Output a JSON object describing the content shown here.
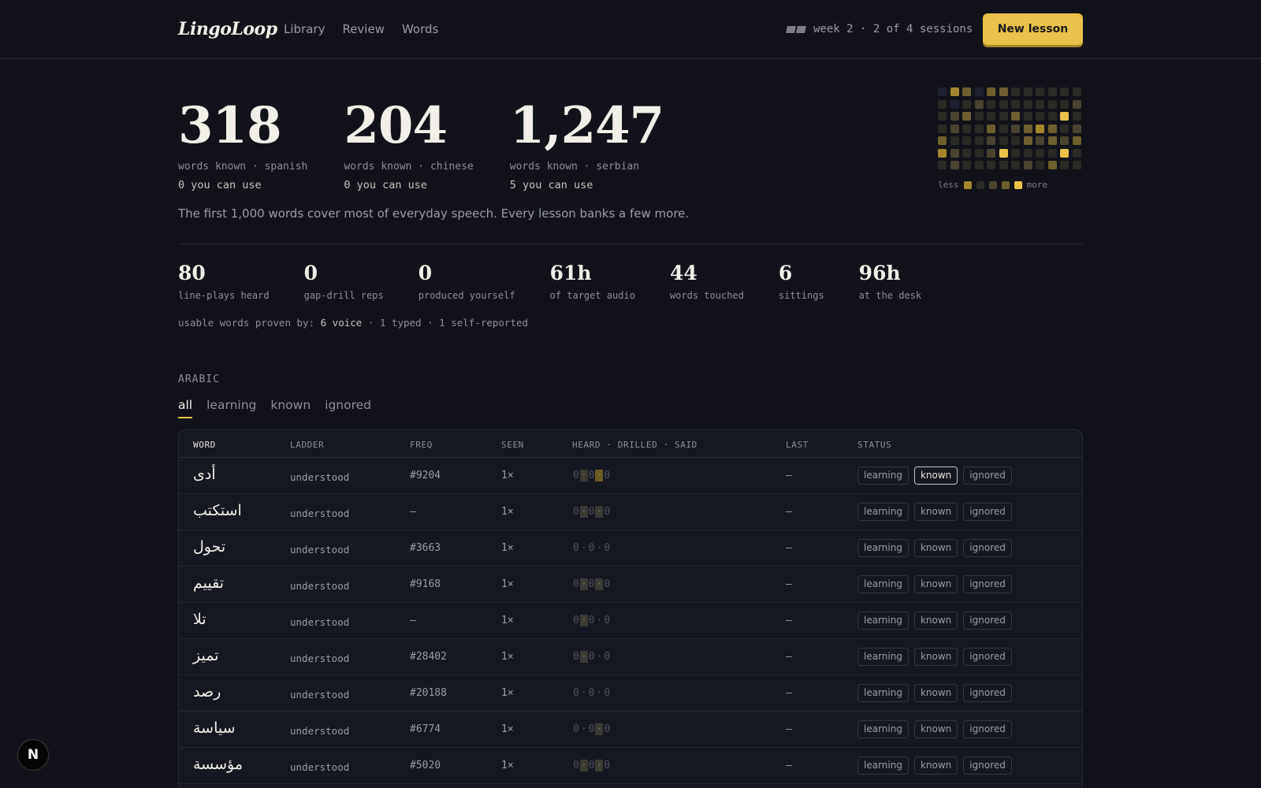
{
  "app": {
    "logo": "LingoLoop"
  },
  "nav": {
    "items": [
      "Library",
      "Review",
      "Words"
    ]
  },
  "header": {
    "week_status": "week 2 · 2 of 4 sessions",
    "new_lesson": "New lesson"
  },
  "hero": {
    "stats": [
      {
        "value": "318",
        "label": "words known · spanish",
        "usable": "0 you can use"
      },
      {
        "value": "204",
        "label": "words known · chinese",
        "usable": "0 you can use"
      },
      {
        "value": "1,247",
        "label": "words known · serbian",
        "usable": "5 you can use"
      }
    ],
    "tagline": "The first 1,000 words cover most of everyday speech. Every lesson banks a few more."
  },
  "heatmap": {
    "less": "less",
    "more": "more",
    "colors": [
      "#1e2130",
      "#2b2a25",
      "#4a4330",
      "#6e5f30",
      "#a3872e",
      "#e8c24a"
    ],
    "levels": [
      [
        0,
        4,
        3,
        0,
        3,
        3,
        1,
        1,
        1,
        1,
        1,
        1
      ],
      [
        1,
        0,
        1,
        2,
        1,
        1,
        1,
        1,
        1,
        1,
        1,
        2
      ],
      [
        1,
        2,
        3,
        1,
        1,
        1,
        3,
        1,
        1,
        1,
        5,
        1
      ],
      [
        1,
        2,
        1,
        1,
        3,
        1,
        2,
        3,
        4,
        3,
        1,
        2
      ],
      [
        3,
        1,
        1,
        1,
        2,
        1,
        1,
        3,
        2,
        3,
        2,
        3
      ],
      [
        4,
        2,
        1,
        1,
        2,
        5,
        1,
        1,
        1,
        1,
        5,
        1
      ],
      [
        1,
        2,
        1,
        1,
        1,
        1,
        1,
        2,
        1,
        3,
        1,
        1
      ]
    ],
    "legend_levels": [
      4,
      1,
      2,
      3,
      5
    ]
  },
  "small_stats": [
    {
      "value": "80",
      "label": "line-plays heard"
    },
    {
      "value": "0",
      "label": "gap-drill reps"
    },
    {
      "value": "0",
      "label": "produced yourself"
    },
    {
      "value": "61h",
      "label": "of target audio"
    },
    {
      "value": "44",
      "label": "words touched"
    },
    {
      "value": "6",
      "label": "sittings"
    },
    {
      "value": "96h",
      "label": "at the desk"
    }
  ],
  "proven": {
    "prefix": "usable words proven by:",
    "voice": "6 voice",
    "rest": "· 1 typed · 1 self-reported"
  },
  "section": {
    "title": "ARABIC"
  },
  "filters": [
    "all",
    "learning",
    "known",
    "ignored"
  ],
  "table": {
    "headers": [
      "WORD",
      "LADDER",
      "FREQ",
      "SEEN",
      "HEARD · DRILLED · SAID",
      "LAST",
      "STATUS"
    ],
    "status_options": [
      "learning",
      "known",
      "ignored"
    ],
    "rows": [
      {
        "word": "أدى",
        "ladder": "understood",
        "freq": "#9204",
        "seen": "1×",
        "hds": [
          "0",
          "·",
          "0",
          "·",
          "0"
        ],
        "hl": [
          0,
          1,
          0,
          2,
          0
        ],
        "last": "—",
        "status": "known"
      },
      {
        "word": "استكتب",
        "ladder": "understood",
        "freq": "—",
        "seen": "1×",
        "hds": [
          "0",
          "·",
          "0",
          "·",
          "0"
        ],
        "hl": [
          0,
          1,
          0,
          1,
          0
        ],
        "last": "—",
        "status": ""
      },
      {
        "word": "تحول",
        "ladder": "understood",
        "freq": "#3663",
        "seen": "1×",
        "hds": [
          "0",
          "·",
          "0",
          "·",
          "0"
        ],
        "hl": [
          0,
          0,
          0,
          0,
          0
        ],
        "last": "—",
        "status": ""
      },
      {
        "word": "تقييم",
        "ladder": "understood",
        "freq": "#9168",
        "seen": "1×",
        "hds": [
          "0",
          "·",
          "0",
          "·",
          "0"
        ],
        "hl": [
          0,
          1,
          0,
          1,
          0
        ],
        "last": "—",
        "status": ""
      },
      {
        "word": "تلا",
        "ladder": "understood",
        "freq": "—",
        "seen": "1×",
        "hds": [
          "0",
          "·",
          "0",
          "·",
          "0"
        ],
        "hl": [
          0,
          1,
          0,
          0,
          0
        ],
        "last": "—",
        "status": ""
      },
      {
        "word": "تميز",
        "ladder": "understood",
        "freq": "#28402",
        "seen": "1×",
        "hds": [
          "0",
          "·",
          "0",
          "·",
          "0"
        ],
        "hl": [
          0,
          1,
          0,
          0,
          0
        ],
        "last": "—",
        "status": ""
      },
      {
        "word": "رصد",
        "ladder": "understood",
        "freq": "#20188",
        "seen": "1×",
        "hds": [
          "0",
          "·",
          "0",
          "·",
          "0"
        ],
        "hl": [
          0,
          0,
          0,
          0,
          0
        ],
        "last": "—",
        "status": ""
      },
      {
        "word": "سياسة",
        "ladder": "understood",
        "freq": "#6774",
        "seen": "1×",
        "hds": [
          "0",
          "·",
          "0",
          "·",
          "0"
        ],
        "hl": [
          0,
          0,
          0,
          1,
          0
        ],
        "last": "—",
        "status": ""
      },
      {
        "word": "مؤسسة",
        "ladder": "understood",
        "freq": "#5020",
        "seen": "1×",
        "hds": [
          "0",
          "·",
          "0",
          "·",
          "0"
        ],
        "hl": [
          0,
          1,
          0,
          1,
          0
        ],
        "last": "—",
        "status": ""
      }
    ]
  },
  "badge": {
    "letter": "N"
  }
}
